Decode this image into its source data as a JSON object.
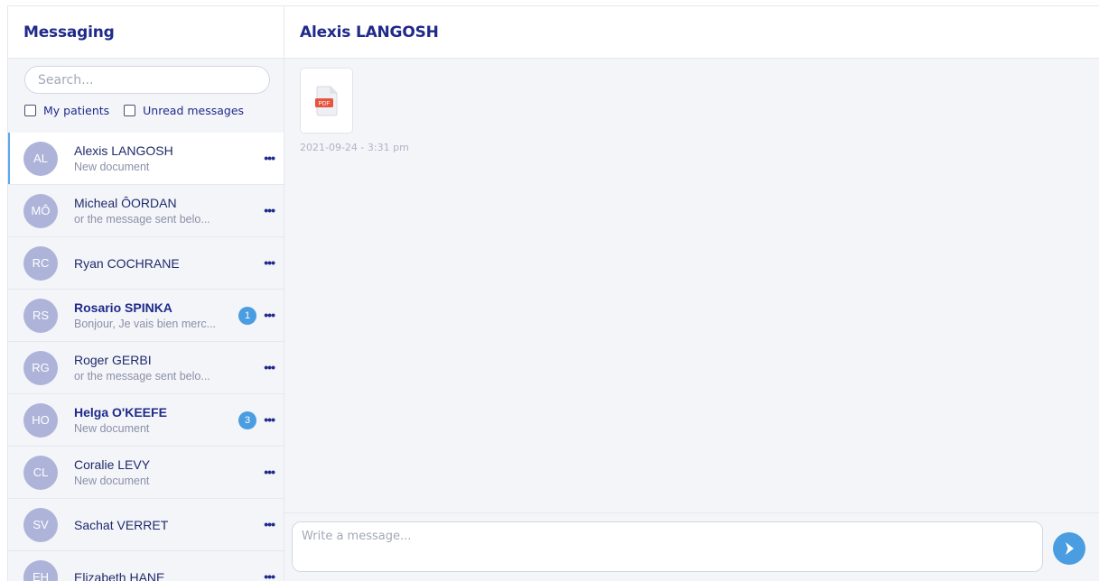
{
  "sidebar": {
    "title": "Messaging",
    "search_placeholder": "Search...",
    "filters": [
      {
        "label": "My patients"
      },
      {
        "label": "Unread messages"
      }
    ],
    "conversations": [
      {
        "initials": "AL",
        "name": "Alexis LANGOSH",
        "preview": "New document",
        "unread": "",
        "bold": false,
        "active": true
      },
      {
        "initials": "MÔ",
        "name": "Micheal ÔORDAN",
        "preview": "or the message sent belo...",
        "unread": "",
        "bold": false,
        "active": false
      },
      {
        "initials": "RC",
        "name": "Ryan COCHRANE",
        "preview": "",
        "unread": "",
        "bold": false,
        "active": false
      },
      {
        "initials": "RS",
        "name": "Rosario SPINKA",
        "preview": "Bonjour, Je vais bien merc...",
        "unread": "1",
        "bold": true,
        "active": false
      },
      {
        "initials": "RG",
        "name": "Roger GERBI",
        "preview": "or the message sent belo...",
        "unread": "",
        "bold": false,
        "active": false
      },
      {
        "initials": "HO",
        "name": "Helga O'KEEFE",
        "preview": "New document",
        "unread": "3",
        "bold": true,
        "active": false
      },
      {
        "initials": "CL",
        "name": "Coralie LEVY",
        "preview": "New document",
        "unread": "",
        "bold": false,
        "active": false
      },
      {
        "initials": "SV",
        "name": "Sachat VERRET",
        "preview": "",
        "unread": "",
        "bold": false,
        "active": false
      },
      {
        "initials": "EH",
        "name": "Elizabeth HANE",
        "preview": "",
        "unread": "",
        "bold": false,
        "active": false
      }
    ]
  },
  "conversation": {
    "contact_name": "Alexis LANGOSH",
    "messages": [
      {
        "type": "attachment",
        "file_type": "PDF",
        "icon": "pdf-file-icon",
        "timestamp": "2021-09-24 - 3:31 pm"
      }
    ]
  },
  "composer": {
    "placeholder": "Write a message...",
    "send_icon": "send-arrow-icon"
  },
  "colors": {
    "accent": "#4a9de0",
    "title": "#1f2a8a",
    "avatar": "#aeb4d9",
    "active_indicator": "#5aa8e8",
    "pdf_badge": "#e8553f"
  }
}
